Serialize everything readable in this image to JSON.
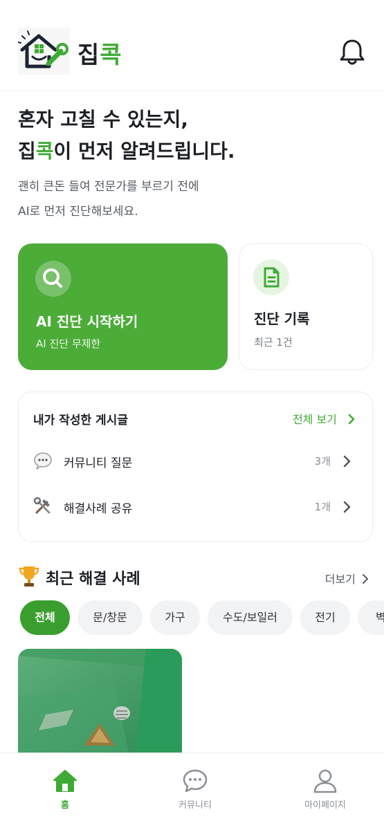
{
  "header": {
    "brand_part1": "집",
    "brand_part2": "콕",
    "icons": {
      "logo": "house-wrench-logo",
      "notification": "bell-icon"
    }
  },
  "hero": {
    "line1": "혼자 고칠 수 있는지,",
    "line2_brand_a": "집",
    "line2_brand_b": "콕",
    "line2_rest": "이 먼저 알려드립니다.",
    "sub1": "괜히 큰돈 들여 전문가를 부르기 전에",
    "sub2": "AI로 먼저 진단해보세요."
  },
  "cards": {
    "ai": {
      "title": "AI 진단 시작하기",
      "subtitle": "AI 진단 무제한",
      "icon": "search-icon"
    },
    "history": {
      "title": "진단 기록",
      "subtitle": "최근 1건",
      "icon": "document-icon"
    }
  },
  "my_posts": {
    "title": "내가 작성한 게시글",
    "view_all": "전체 보기",
    "rows": [
      {
        "label": "커뮤니티 질문",
        "count": "3개",
        "icon": "speech-bubble-icon"
      },
      {
        "label": "해결사례 공유",
        "count": "1개",
        "icon": "tools-icon"
      }
    ]
  },
  "recent": {
    "title": "최근 해결 사례",
    "more": "더보기",
    "chips": [
      "전체",
      "문/창문",
      "가구",
      "수도/보일러",
      "전기",
      "벽/"
    ],
    "active_chip": 0
  },
  "tabbar": {
    "items": [
      {
        "label": "홈",
        "icon": "home-icon",
        "active": true
      },
      {
        "label": "커뮤니티",
        "icon": "chat-icon",
        "active": false
      },
      {
        "label": "마이페이지",
        "icon": "person-icon",
        "active": false
      }
    ]
  },
  "colors": {
    "brand_green": "#3faa35",
    "card_green": "#4cac38",
    "text_dark": "#1c1f24"
  }
}
